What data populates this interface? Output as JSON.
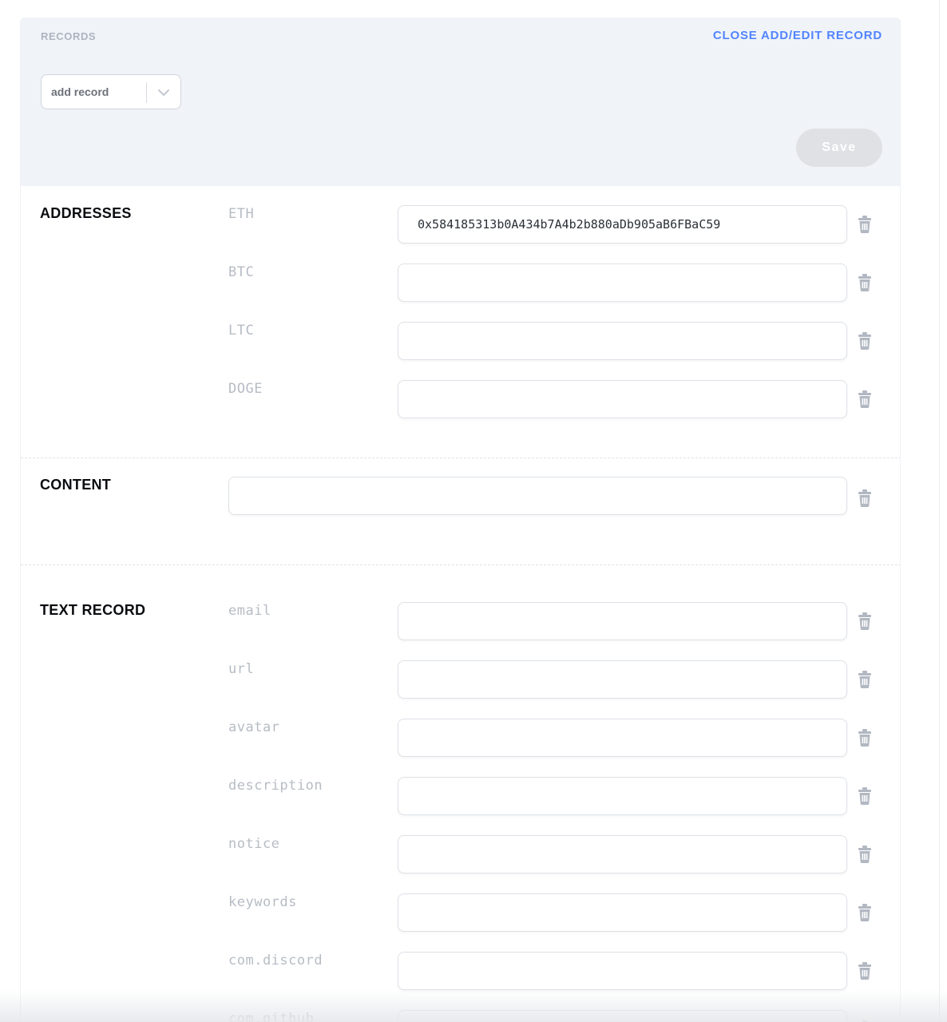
{
  "header": {
    "title": "RECORDS",
    "close_label": "CLOSE ADD/EDIT RECORD",
    "select_value": "add record",
    "save_label": "Save"
  },
  "sections": {
    "addresses": {
      "label": "ADDRESSES",
      "rows": [
        {
          "key": "ETH",
          "value": "0x584185313b0A434b7A4b2b880aDb905aB6FBaC59"
        },
        {
          "key": "BTC",
          "value": ""
        },
        {
          "key": "LTC",
          "value": ""
        },
        {
          "key": "DOGE",
          "value": ""
        }
      ]
    },
    "content": {
      "label": "CONTENT",
      "value": ""
    },
    "text_record": {
      "label": "TEXT RECORD",
      "rows": [
        {
          "key": "email",
          "value": ""
        },
        {
          "key": "url",
          "value": ""
        },
        {
          "key": "avatar",
          "value": ""
        },
        {
          "key": "description",
          "value": ""
        },
        {
          "key": "notice",
          "value": ""
        },
        {
          "key": "keywords",
          "value": ""
        },
        {
          "key": "com.discord",
          "value": ""
        },
        {
          "key": "com.github",
          "value": ""
        }
      ]
    }
  },
  "icons": {
    "trash": "trash-icon",
    "chevron": "chevron-down-icon"
  },
  "colors": {
    "accent": "#5284ff",
    "header_bg": "#f0f4f8",
    "save_disabled": "#dfe1e4",
    "trash_icon": "#b2b8c2"
  }
}
